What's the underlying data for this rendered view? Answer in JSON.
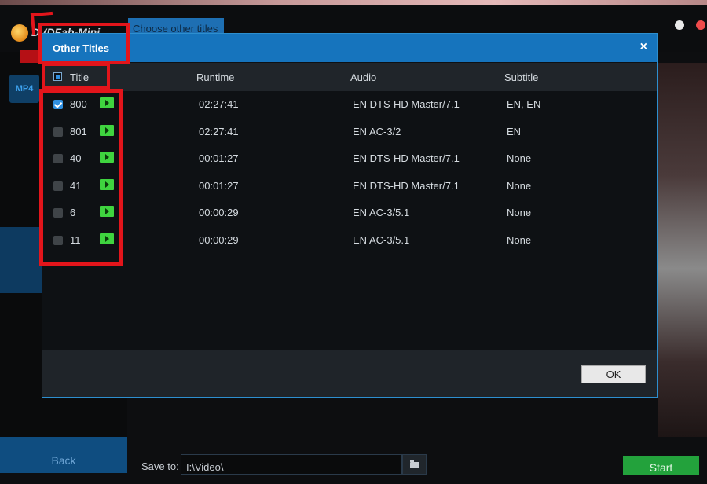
{
  "app": {
    "name": "DVDFab-Mini",
    "choose_tab": "Choose other titles",
    "format_badge": "MP4",
    "back_label": "Back",
    "save_label": "Save to:",
    "save_path": "I:\\Video\\",
    "start_label": "Start"
  },
  "dialog": {
    "title": "Other Titles",
    "close_label": "×",
    "columns": {
      "title": "Title",
      "runtime": "Runtime",
      "audio": "Audio",
      "subtitle": "Subtitle"
    },
    "rows": [
      {
        "title": "800",
        "checked": true,
        "runtime": "02:27:41",
        "audio": "EN  DTS-HD Master/7.1",
        "subtitle": "EN, EN"
      },
      {
        "title": "801",
        "checked": false,
        "runtime": "02:27:41",
        "audio": "EN  AC-3/2",
        "subtitle": "EN"
      },
      {
        "title": "40",
        "checked": false,
        "runtime": "00:01:27",
        "audio": "EN  DTS-HD Master/7.1",
        "subtitle": "None"
      },
      {
        "title": "41",
        "checked": false,
        "runtime": "00:01:27",
        "audio": "EN  DTS-HD Master/7.1",
        "subtitle": "None"
      },
      {
        "title": "6",
        "checked": false,
        "runtime": "00:00:29",
        "audio": "EN  AC-3/5.1",
        "subtitle": "None"
      },
      {
        "title": "11",
        "checked": false,
        "runtime": "00:00:29",
        "audio": "EN  AC-3/5.1",
        "subtitle": "None"
      }
    ],
    "ok_label": "OK"
  },
  "colors": {
    "accent": "#1674bd",
    "annotation": "#e3151b",
    "play": "#3fd43f",
    "start": "#23a23c"
  }
}
